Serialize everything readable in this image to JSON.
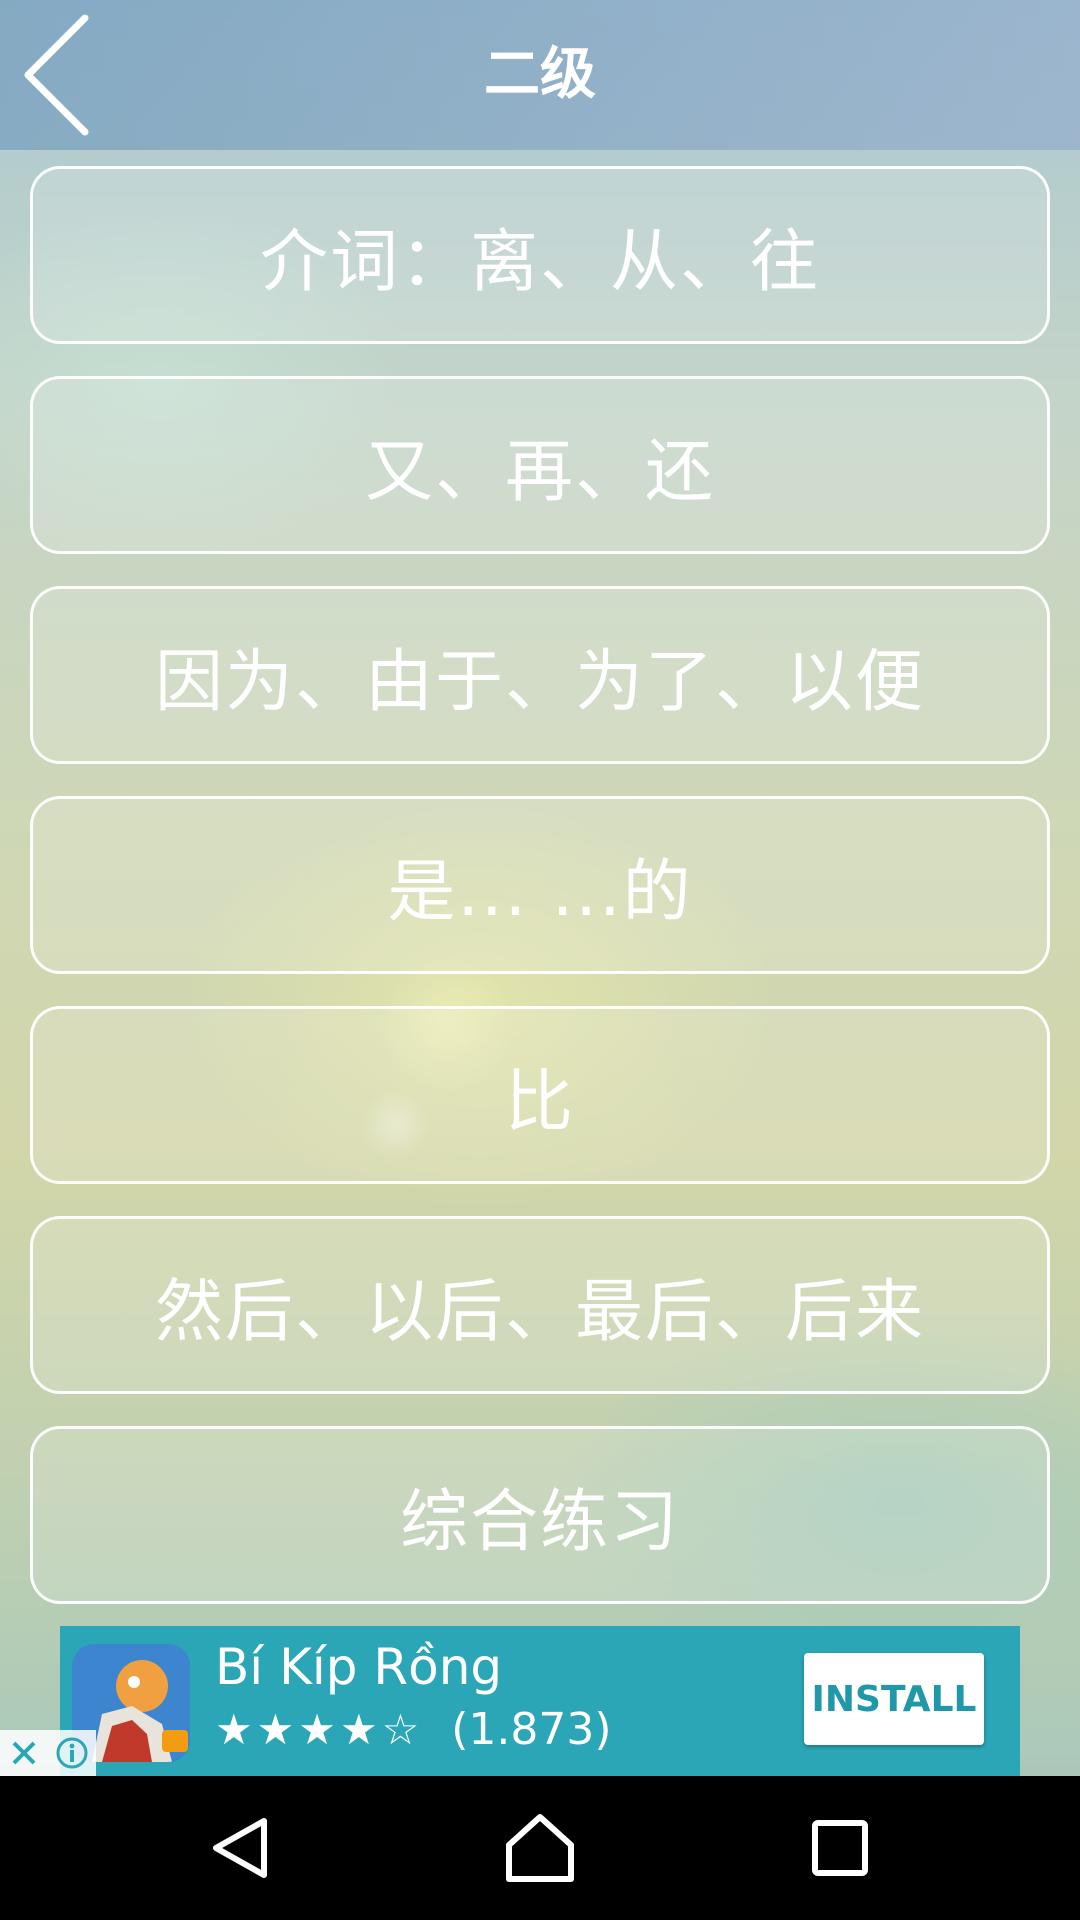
{
  "header": {
    "title": "二级"
  },
  "menu": {
    "items": [
      {
        "label": "介词：离、从、往"
      },
      {
        "label": "又、再、还"
      },
      {
        "label": "因为、由于、为了、以便"
      },
      {
        "label": "是... ...的"
      },
      {
        "label": "比"
      },
      {
        "label": "然后、以后、最后、后来"
      },
      {
        "label": "综合练习"
      }
    ]
  },
  "ad": {
    "app_name": "Bí Kíp Rồng",
    "stars": "★★★★☆",
    "rating_value": 4,
    "rating_count": "(1.873)",
    "install_label": "INSTALL",
    "icon": "game-app-icon"
  },
  "navigation": {
    "back_icon": "triangle-back-icon",
    "home_icon": "home-icon",
    "recents_icon": "square-recents-icon"
  },
  "colors": {
    "ad_background": "#2aa6b7",
    "install_text": "#1f98aa",
    "nav_bar": "#000000"
  }
}
